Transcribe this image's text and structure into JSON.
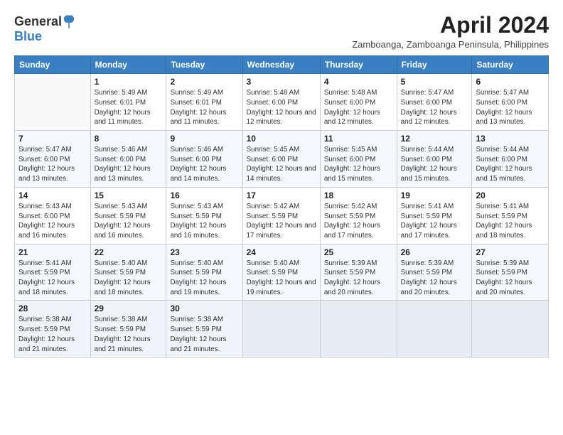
{
  "logo": {
    "general": "General",
    "blue": "Blue",
    "tagline": ""
  },
  "header": {
    "month_year": "April 2024",
    "location": "Zamboanga, Zamboanga Peninsula, Philippines"
  },
  "weekdays": [
    "Sunday",
    "Monday",
    "Tuesday",
    "Wednesday",
    "Thursday",
    "Friday",
    "Saturday"
  ],
  "weeks": [
    [
      {
        "day": "",
        "sunrise": "",
        "sunset": "",
        "daylight": ""
      },
      {
        "day": "1",
        "sunrise": "Sunrise: 5:49 AM",
        "sunset": "Sunset: 6:01 PM",
        "daylight": "Daylight: 12 hours and 11 minutes."
      },
      {
        "day": "2",
        "sunrise": "Sunrise: 5:49 AM",
        "sunset": "Sunset: 6:01 PM",
        "daylight": "Daylight: 12 hours and 11 minutes."
      },
      {
        "day": "3",
        "sunrise": "Sunrise: 5:48 AM",
        "sunset": "Sunset: 6:00 PM",
        "daylight": "Daylight: 12 hours and 12 minutes."
      },
      {
        "day": "4",
        "sunrise": "Sunrise: 5:48 AM",
        "sunset": "Sunset: 6:00 PM",
        "daylight": "Daylight: 12 hours and 12 minutes."
      },
      {
        "day": "5",
        "sunrise": "Sunrise: 5:47 AM",
        "sunset": "Sunset: 6:00 PM",
        "daylight": "Daylight: 12 hours and 12 minutes."
      },
      {
        "day": "6",
        "sunrise": "Sunrise: 5:47 AM",
        "sunset": "Sunset: 6:00 PM",
        "daylight": "Daylight: 12 hours and 13 minutes."
      }
    ],
    [
      {
        "day": "7",
        "sunrise": "Sunrise: 5:47 AM",
        "sunset": "Sunset: 6:00 PM",
        "daylight": "Daylight: 12 hours and 13 minutes."
      },
      {
        "day": "8",
        "sunrise": "Sunrise: 5:46 AM",
        "sunset": "Sunset: 6:00 PM",
        "daylight": "Daylight: 12 hours and 13 minutes."
      },
      {
        "day": "9",
        "sunrise": "Sunrise: 5:46 AM",
        "sunset": "Sunset: 6:00 PM",
        "daylight": "Daylight: 12 hours and 14 minutes."
      },
      {
        "day": "10",
        "sunrise": "Sunrise: 5:45 AM",
        "sunset": "Sunset: 6:00 PM",
        "daylight": "Daylight: 12 hours and 14 minutes."
      },
      {
        "day": "11",
        "sunrise": "Sunrise: 5:45 AM",
        "sunset": "Sunset: 6:00 PM",
        "daylight": "Daylight: 12 hours and 15 minutes."
      },
      {
        "day": "12",
        "sunrise": "Sunrise: 5:44 AM",
        "sunset": "Sunset: 6:00 PM",
        "daylight": "Daylight: 12 hours and 15 minutes."
      },
      {
        "day": "13",
        "sunrise": "Sunrise: 5:44 AM",
        "sunset": "Sunset: 6:00 PM",
        "daylight": "Daylight: 12 hours and 15 minutes."
      }
    ],
    [
      {
        "day": "14",
        "sunrise": "Sunrise: 5:43 AM",
        "sunset": "Sunset: 6:00 PM",
        "daylight": "Daylight: 12 hours and 16 minutes."
      },
      {
        "day": "15",
        "sunrise": "Sunrise: 5:43 AM",
        "sunset": "Sunset: 5:59 PM",
        "daylight": "Daylight: 12 hours and 16 minutes."
      },
      {
        "day": "16",
        "sunrise": "Sunrise: 5:43 AM",
        "sunset": "Sunset: 5:59 PM",
        "daylight": "Daylight: 12 hours and 16 minutes."
      },
      {
        "day": "17",
        "sunrise": "Sunrise: 5:42 AM",
        "sunset": "Sunset: 5:59 PM",
        "daylight": "Daylight: 12 hours and 17 minutes."
      },
      {
        "day": "18",
        "sunrise": "Sunrise: 5:42 AM",
        "sunset": "Sunset: 5:59 PM",
        "daylight": "Daylight: 12 hours and 17 minutes."
      },
      {
        "day": "19",
        "sunrise": "Sunrise: 5:41 AM",
        "sunset": "Sunset: 5:59 PM",
        "daylight": "Daylight: 12 hours and 17 minutes."
      },
      {
        "day": "20",
        "sunrise": "Sunrise: 5:41 AM",
        "sunset": "Sunset: 5:59 PM",
        "daylight": "Daylight: 12 hours and 18 minutes."
      }
    ],
    [
      {
        "day": "21",
        "sunrise": "Sunrise: 5:41 AM",
        "sunset": "Sunset: 5:59 PM",
        "daylight": "Daylight: 12 hours and 18 minutes."
      },
      {
        "day": "22",
        "sunrise": "Sunrise: 5:40 AM",
        "sunset": "Sunset: 5:59 PM",
        "daylight": "Daylight: 12 hours and 18 minutes."
      },
      {
        "day": "23",
        "sunrise": "Sunrise: 5:40 AM",
        "sunset": "Sunset: 5:59 PM",
        "daylight": "Daylight: 12 hours and 19 minutes."
      },
      {
        "day": "24",
        "sunrise": "Sunrise: 5:40 AM",
        "sunset": "Sunset: 5:59 PM",
        "daylight": "Daylight: 12 hours and 19 minutes."
      },
      {
        "day": "25",
        "sunrise": "Sunrise: 5:39 AM",
        "sunset": "Sunset: 5:59 PM",
        "daylight": "Daylight: 12 hours and 20 minutes."
      },
      {
        "day": "26",
        "sunrise": "Sunrise: 5:39 AM",
        "sunset": "Sunset: 5:59 PM",
        "daylight": "Daylight: 12 hours and 20 minutes."
      },
      {
        "day": "27",
        "sunrise": "Sunrise: 5:39 AM",
        "sunset": "Sunset: 5:59 PM",
        "daylight": "Daylight: 12 hours and 20 minutes."
      }
    ],
    [
      {
        "day": "28",
        "sunrise": "Sunrise: 5:38 AM",
        "sunset": "Sunset: 5:59 PM",
        "daylight": "Daylight: 12 hours and 21 minutes."
      },
      {
        "day": "29",
        "sunrise": "Sunrise: 5:38 AM",
        "sunset": "Sunset: 5:59 PM",
        "daylight": "Daylight: 12 hours and 21 minutes."
      },
      {
        "day": "30",
        "sunrise": "Sunrise: 5:38 AM",
        "sunset": "Sunset: 5:59 PM",
        "daylight": "Daylight: 12 hours and 21 minutes."
      },
      {
        "day": "",
        "sunrise": "",
        "sunset": "",
        "daylight": ""
      },
      {
        "day": "",
        "sunrise": "",
        "sunset": "",
        "daylight": ""
      },
      {
        "day": "",
        "sunrise": "",
        "sunset": "",
        "daylight": ""
      },
      {
        "day": "",
        "sunrise": "",
        "sunset": "",
        "daylight": ""
      }
    ]
  ]
}
